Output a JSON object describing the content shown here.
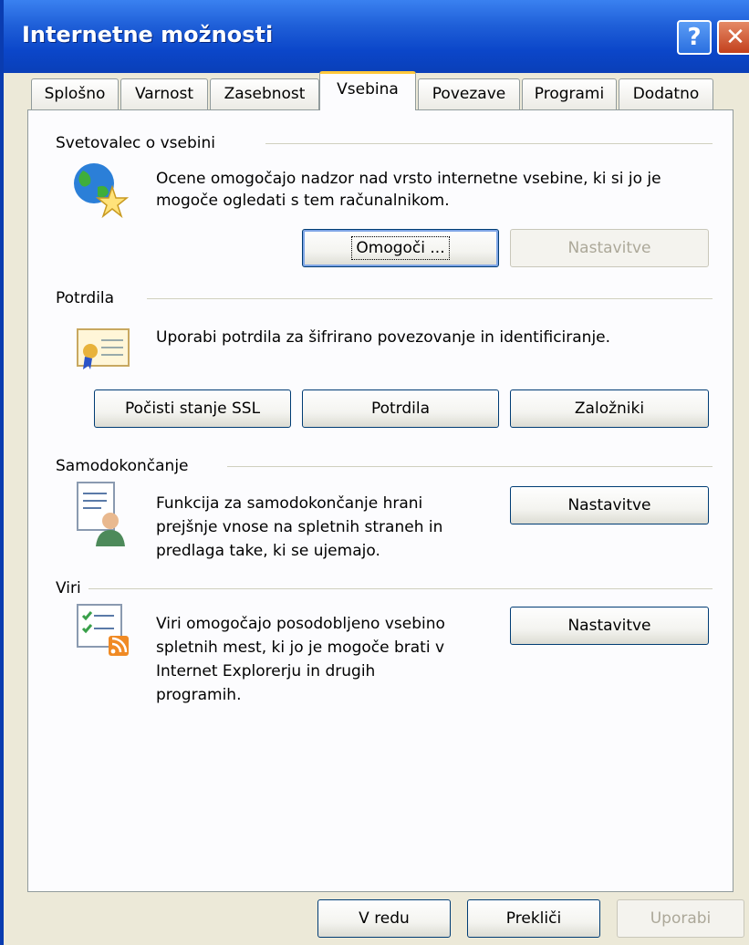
{
  "window": {
    "title": "Internetne možnosti",
    "help_glyph": "?",
    "close_glyph": "✕"
  },
  "tabs": [
    {
      "label": "Splošno"
    },
    {
      "label": "Varnost"
    },
    {
      "label": "Zasebnost"
    },
    {
      "label": "Vsebina",
      "active": true
    },
    {
      "label": "Povezave"
    },
    {
      "label": "Programi"
    },
    {
      "label": "Dodatno"
    }
  ],
  "content_advisor": {
    "heading": "Svetovalec o vsebini",
    "description_line1": "Ocene omogočajo nadzor nad vrsto internetne vsebine, ki si jo je",
    "description_line2": "mogoče ogledati s tem računalnikom.",
    "enable_label": "Omogoči ...",
    "settings_label": "Nastavitve",
    "icon": "globe-star-icon"
  },
  "certificates": {
    "heading": "Potrdila",
    "description": "Uporabi potrdila za šifrirano povezovanje in identificiranje.",
    "clear_ssl_label": "Počisti stanje SSL",
    "certificates_label": "Potrdila",
    "publishers_label": "Založniki",
    "icon": "certificate-icon"
  },
  "autocomplete": {
    "heading": "Samodokončanje",
    "description_line1": "Funkcija za samodokončanje hrani",
    "description_line2": "prejšnje vnose na spletnih straneh in",
    "description_line3": "predlaga take, ki se ujemajo.",
    "settings_label": "Nastavitve",
    "icon": "autocomplete-user-icon"
  },
  "feeds": {
    "heading": "Viri",
    "description_line1": "Viri omogočajo posodobljeno vsebino",
    "description_line2": "spletnih mest, ki jo je mogoče brati v",
    "description_line3": "Internet Explorerju in drugih",
    "description_line4": "programih.",
    "settings_label": "Nastavitve",
    "icon": "rss-feed-icon"
  },
  "footer": {
    "ok_label": "V redu",
    "cancel_label": "Prekliči",
    "apply_label": "Uporabi"
  },
  "colors": {
    "titlebar": "#0b46c9",
    "active_tab_accent": "#ffc83c",
    "dialog_bg": "#ece9d8"
  }
}
